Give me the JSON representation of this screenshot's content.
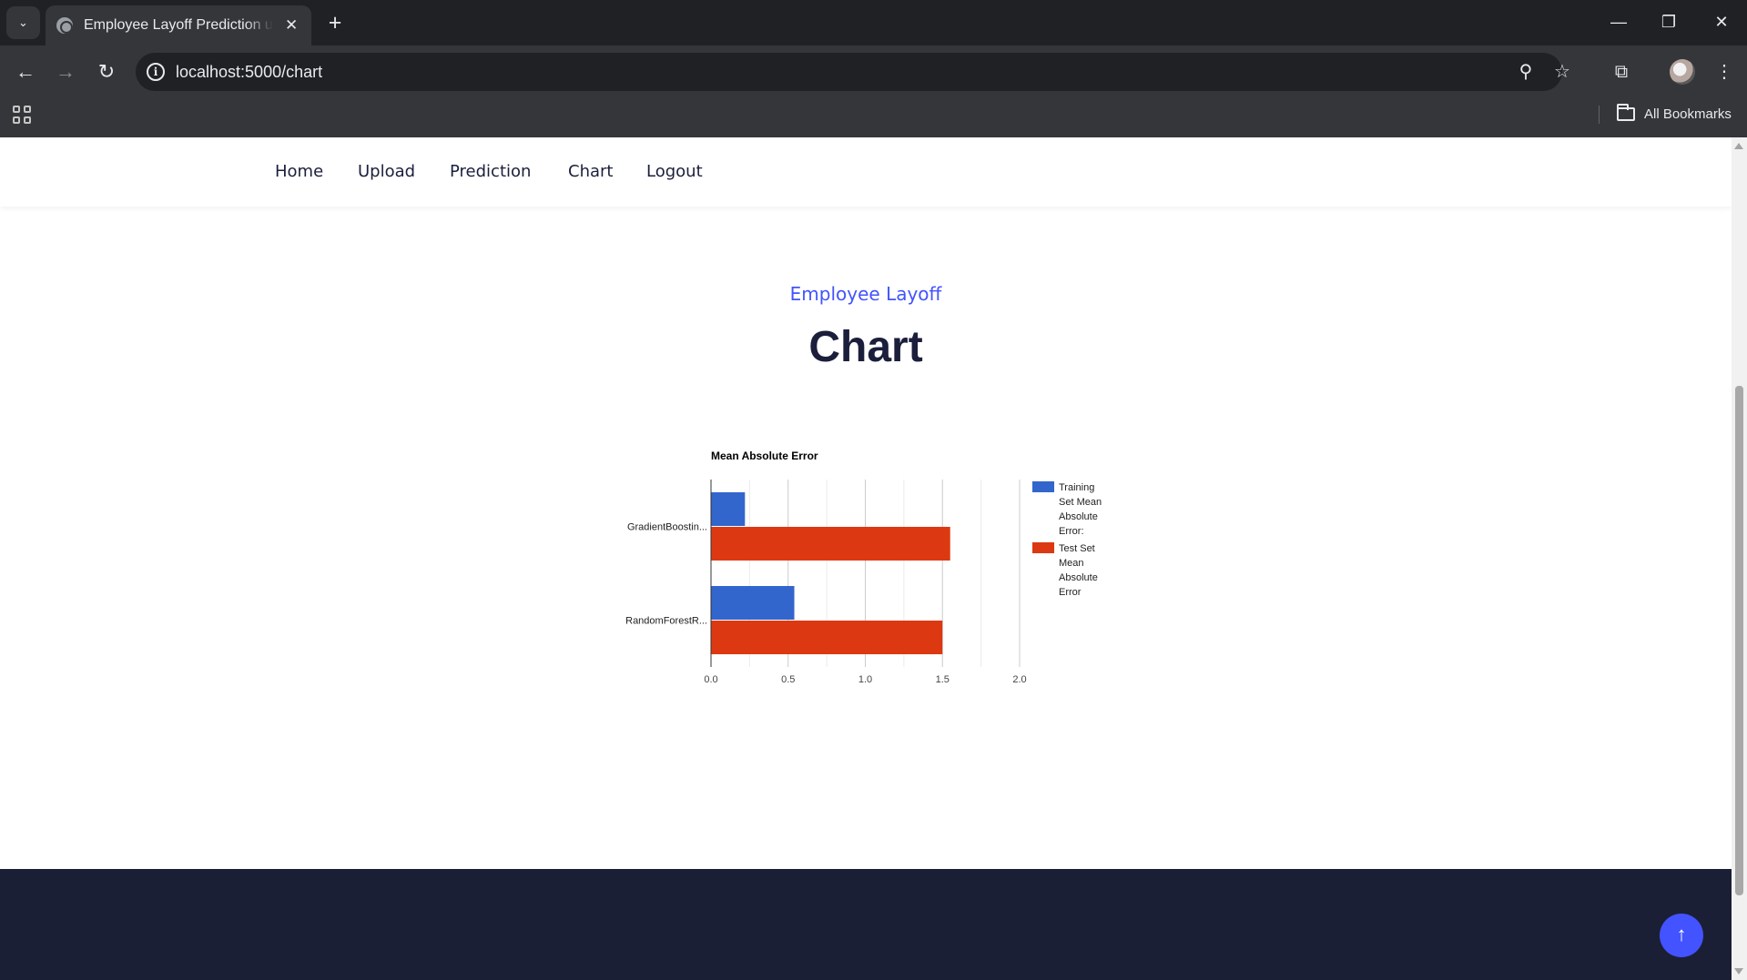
{
  "browser": {
    "tab_title": "Employee Layoff Prediction using",
    "url": "localhost:5000/chart",
    "bookmarks_label": "All Bookmarks"
  },
  "site": {
    "nav": [
      "Home",
      "Upload",
      "Prediction",
      "Chart",
      "Logout"
    ],
    "subtitle": "Employee Layoff",
    "title": "Chart"
  },
  "chart_data": {
    "type": "bar",
    "orientation": "horizontal",
    "title": "Mean Absolute Error",
    "categories": [
      "GradientBoostin...",
      "RandomForestR..."
    ],
    "series": [
      {
        "name": "Training Set Mean Absolute Error:",
        "color": "#3366cc",
        "values": [
          0.22,
          0.54
        ]
      },
      {
        "name": "Test Set Mean Absolute Error",
        "color": "#dc3912",
        "values": [
          1.55,
          1.5
        ]
      }
    ],
    "xlim": [
      0,
      2.0
    ],
    "xticks": [
      "0.0",
      "0.5",
      "1.0",
      "1.5",
      "2.0"
    ],
    "grid": true,
    "legend": "right"
  },
  "colors": {
    "accent": "#4353ff",
    "heading": "#1b1f3b",
    "footer": "#1b1f35"
  }
}
